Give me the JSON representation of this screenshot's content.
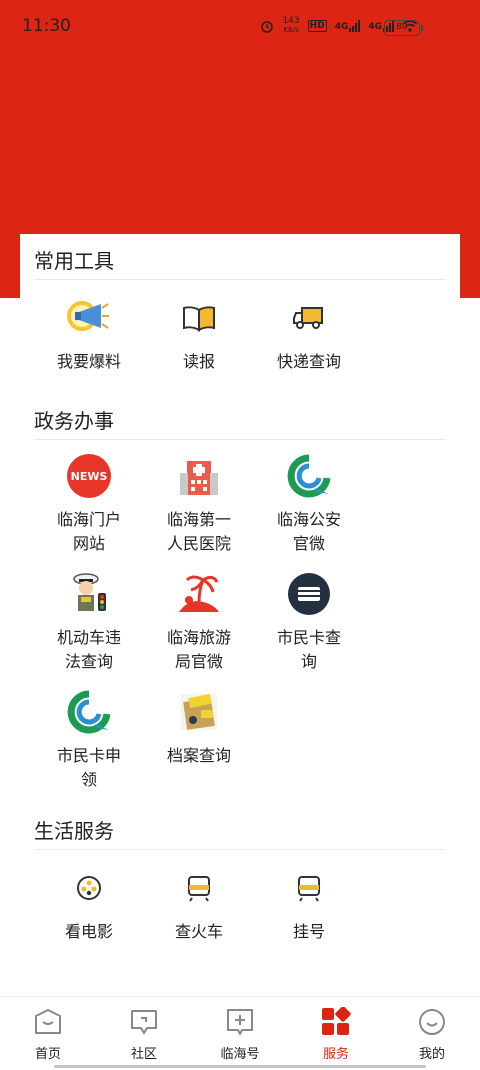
{
  "status_bar": {
    "time": "11:30",
    "speed": "143",
    "speed_unit": "KB/s",
    "hd": "HD",
    "net1": "4G",
    "net2": "4G",
    "battery": "80"
  },
  "sections": [
    {
      "title": "常用工具",
      "items": [
        {
          "label": "我要爆料",
          "icon": "megaphone-icon"
        },
        {
          "label": "读报",
          "icon": "book-icon"
        },
        {
          "label": "快递查询",
          "icon": "truck-icon"
        }
      ]
    },
    {
      "title": "政务办事",
      "items": [
        {
          "label": "临海门户网站",
          "icon": "news-icon",
          "badge": "NEWS"
        },
        {
          "label": "临海第一人民医院",
          "icon": "hospital-icon"
        },
        {
          "label": "临海公安官微",
          "icon": "police-logo-icon"
        },
        {
          "label": "机动车违法查询",
          "icon": "traffic-police-icon"
        },
        {
          "label": "临海旅游局官微",
          "icon": "palm-island-icon"
        },
        {
          "label": "市民卡查询",
          "icon": "citizen-card-icon"
        },
        {
          "label": "市民卡申领",
          "icon": "citizen-card-apply-icon"
        },
        {
          "label": "档案查询",
          "icon": "archive-icon"
        }
      ]
    },
    {
      "title": "生活服务",
      "items": [
        {
          "label": "看电影",
          "icon": "film-reel-icon"
        },
        {
          "label": "查火车",
          "icon": "train-icon"
        },
        {
          "label": "挂号",
          "icon": "train-icon"
        }
      ]
    }
  ],
  "bottom_nav": [
    {
      "label": "首页",
      "icon": "home-icon"
    },
    {
      "label": "社区",
      "icon": "chat-icon"
    },
    {
      "label": "临海号",
      "icon": "plus-square-icon"
    },
    {
      "label": "服务",
      "icon": "service-grid-icon",
      "active": true
    },
    {
      "label": "我的",
      "icon": "smile-icon"
    }
  ],
  "colors": {
    "brand_red": "#dc2512"
  }
}
